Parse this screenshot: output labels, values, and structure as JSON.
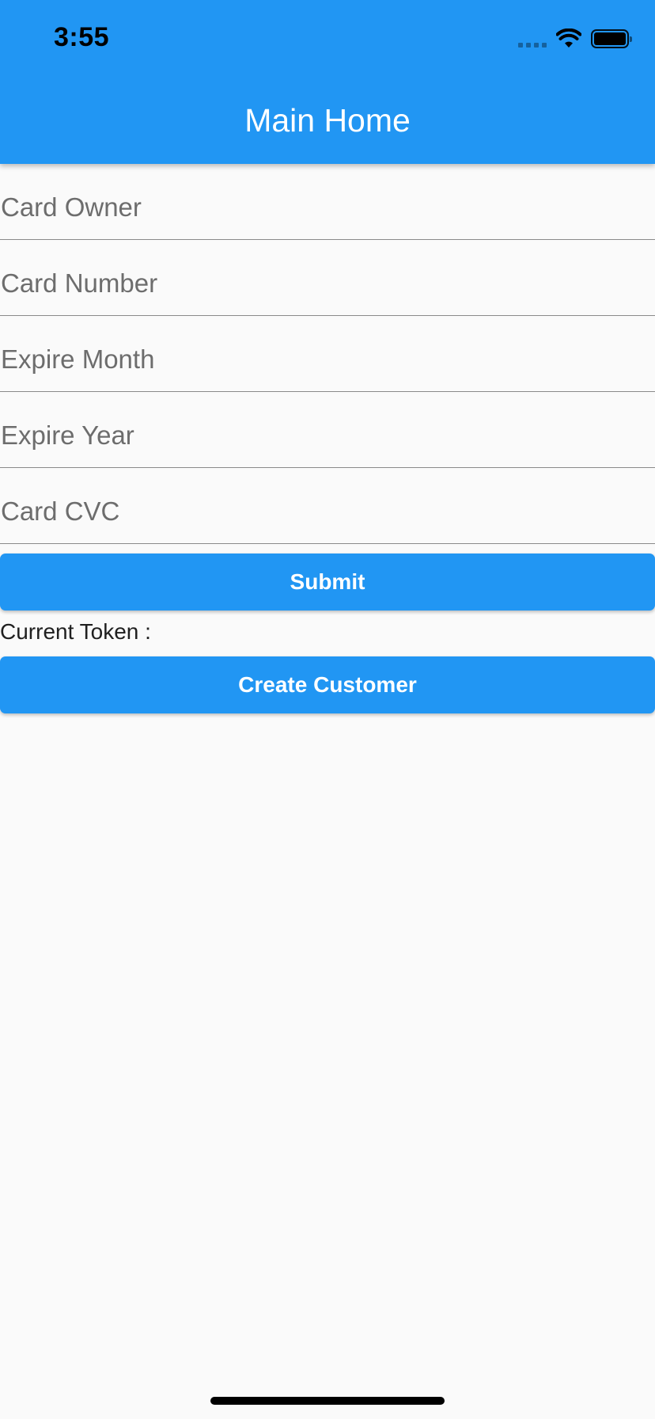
{
  "status_bar": {
    "time": "3:55",
    "icons": [
      "cellular-signal-icon",
      "wifi-icon",
      "battery-icon"
    ]
  },
  "app_bar": {
    "title": "Main Home",
    "color": "#2196f3"
  },
  "form": {
    "fields": [
      {
        "placeholder": "Card Owner",
        "value": ""
      },
      {
        "placeholder": "Card Number",
        "value": ""
      },
      {
        "placeholder": "Expire Month",
        "value": ""
      },
      {
        "placeholder": "Expire Year",
        "value": ""
      },
      {
        "placeholder": "Card CVC",
        "value": ""
      }
    ],
    "submit_label": "Submit",
    "token_label": "Current Token :",
    "create_customer_label": "Create Customer"
  },
  "colors": {
    "primary": "#2196f3",
    "background": "#fafafa"
  }
}
